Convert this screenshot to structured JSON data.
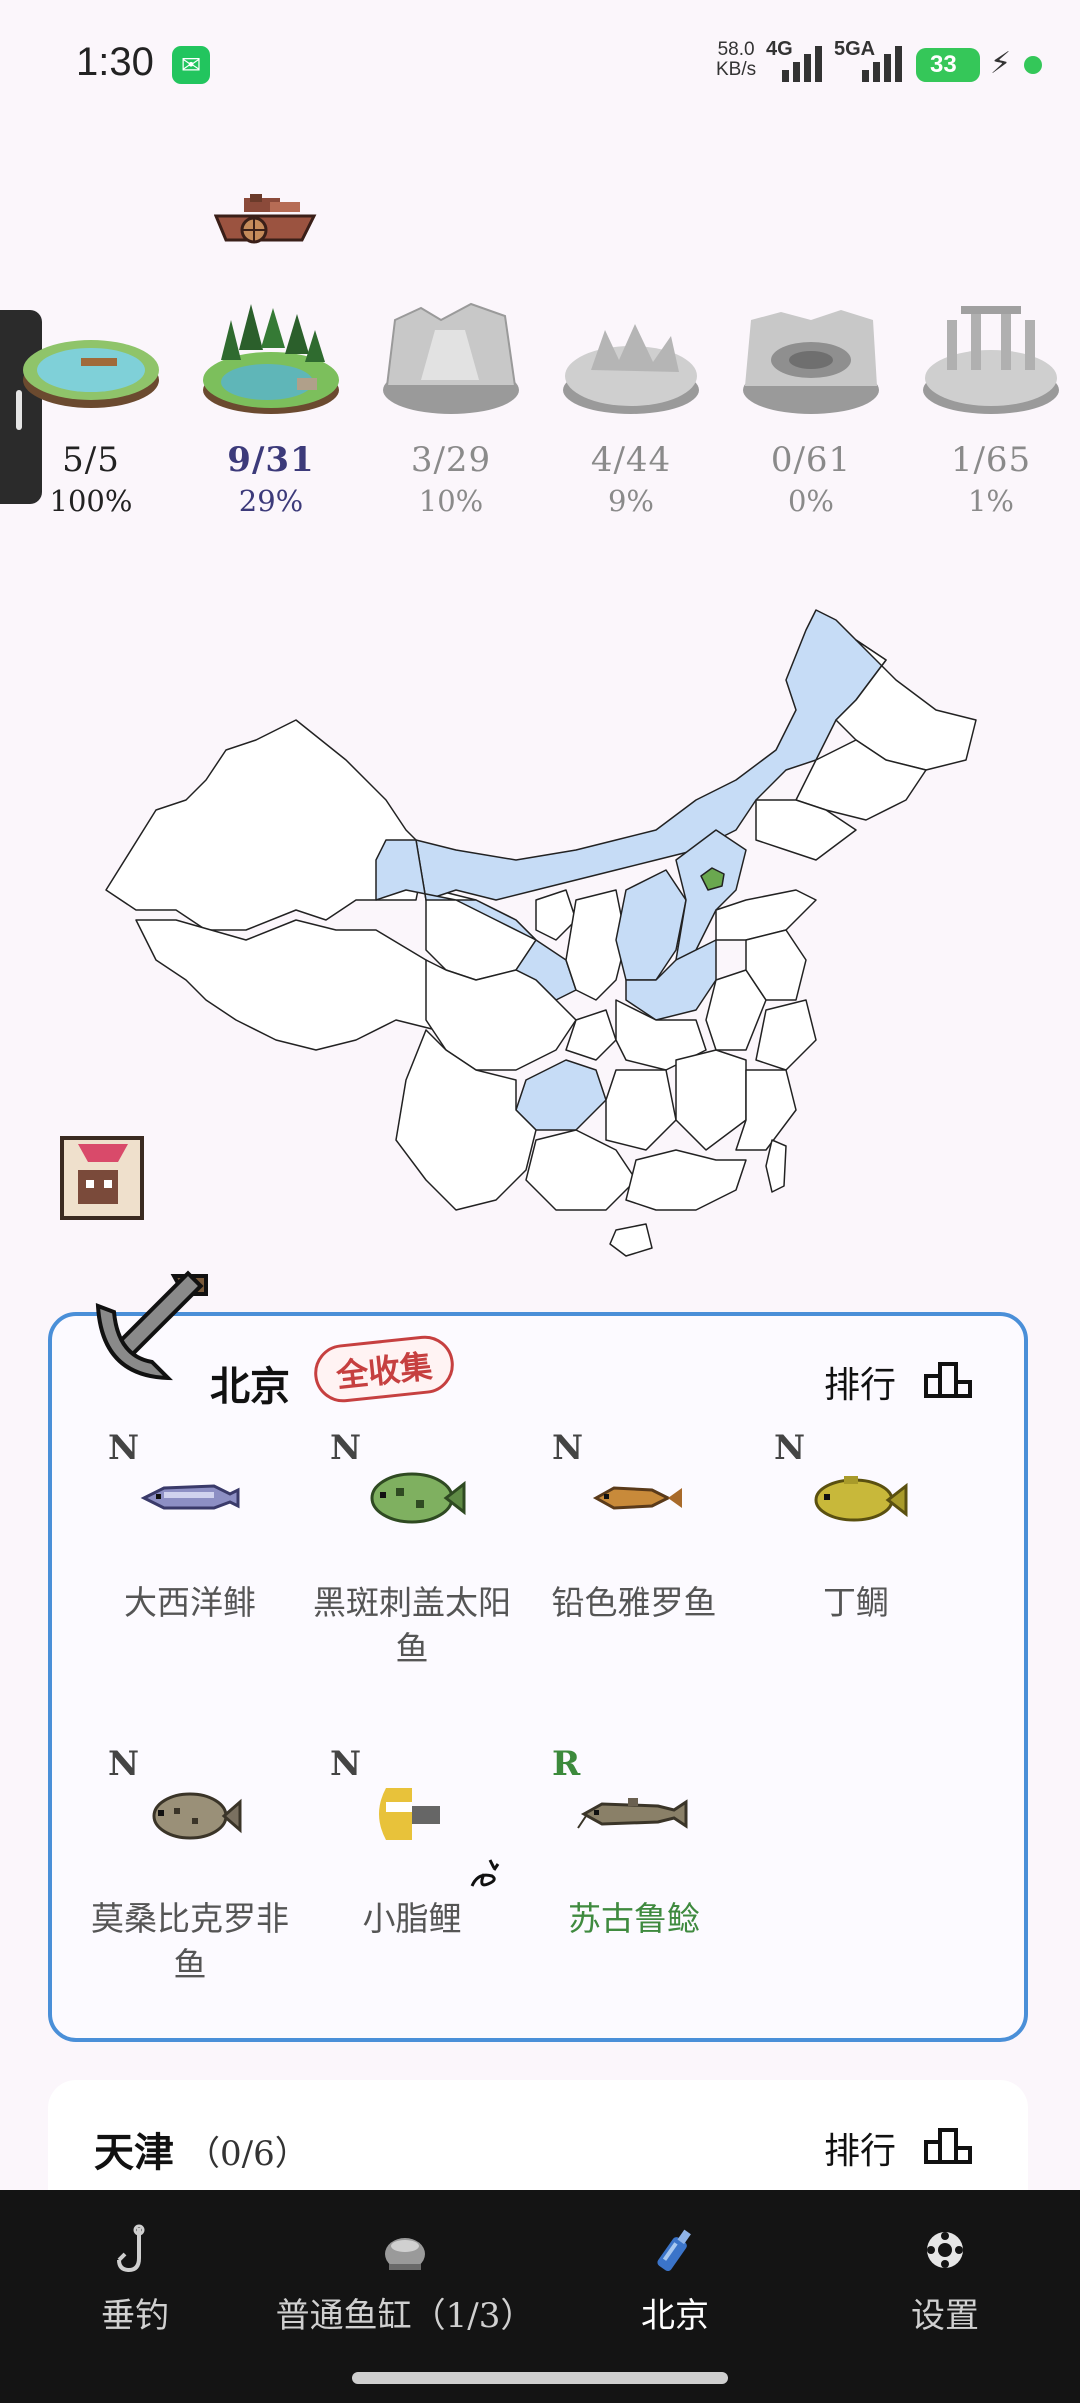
{
  "status_bar": {
    "time": "1:30",
    "net_speed_value": "58.0",
    "net_speed_unit": "KB/s",
    "sim1": "4G",
    "sim2": "5GA",
    "battery": "33"
  },
  "regions": [
    {
      "count": "5/5",
      "percent": "100%",
      "state": "done"
    },
    {
      "count": "9/31",
      "percent": "29%",
      "state": "active"
    },
    {
      "count": "3/29",
      "percent": "10%",
      "state": "locked"
    },
    {
      "count": "4/44",
      "percent": "9%",
      "state": "locked"
    },
    {
      "count": "0/61",
      "percent": "0%",
      "state": "locked"
    },
    {
      "count": "1/65",
      "percent": "1%",
      "state": "locked"
    }
  ],
  "province_card": {
    "title": "北京",
    "badge": "全收集",
    "rank_label": "排行",
    "fish": [
      {
        "rarity": "N",
        "name": "大西洋鲱"
      },
      {
        "rarity": "N",
        "name": "黑斑刺盖太阳鱼"
      },
      {
        "rarity": "N",
        "name": "铅色雅罗鱼"
      },
      {
        "rarity": "N",
        "name": "丁鲷"
      },
      {
        "rarity": "N",
        "name": "莫桑比克罗非鱼"
      },
      {
        "rarity": "N",
        "name": "小脂鲤"
      },
      {
        "rarity": "R",
        "name": "苏古鲁鲶"
      }
    ]
  },
  "next_card": {
    "title": "天津",
    "count": "（0/6）",
    "rank_label": "排行"
  },
  "bottom_nav": [
    {
      "label": "垂钓",
      "icon": "fishhook-icon"
    },
    {
      "label": "普通鱼缸（1/3）",
      "icon": "fish-tank-icon"
    },
    {
      "label": "北京",
      "icon": "bottle-icon",
      "active": true
    },
    {
      "label": "设置",
      "icon": "settings-icon"
    }
  ],
  "colors": {
    "accent_border": "#4a8fd8",
    "explored_region": "#c6dcf6",
    "current_region": "#6aa84f",
    "badge_red": "#c64040",
    "rare_green": "#3f8a3f"
  }
}
